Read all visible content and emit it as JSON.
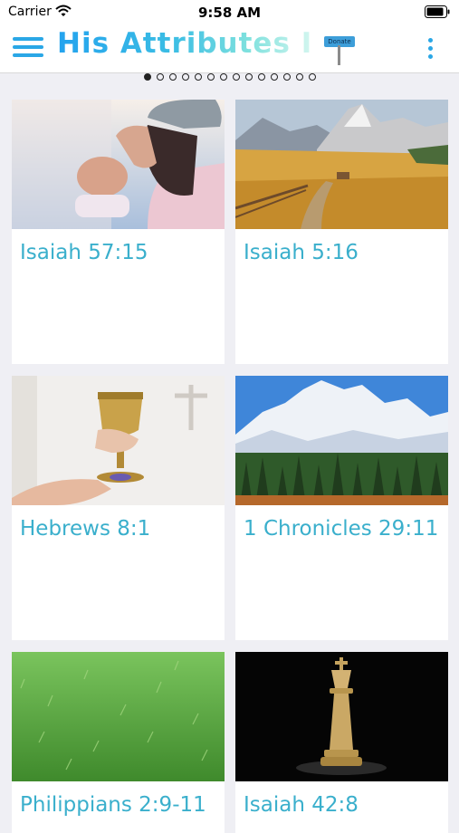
{
  "status_bar": {
    "carrier": "Carrier",
    "time": "9:58 AM"
  },
  "nav": {
    "title": "His Attributes I",
    "donate_label": "Donate"
  },
  "pagination": {
    "total": 14,
    "active_index": 0
  },
  "cards": [
    {
      "title": "Isaiah 57:15",
      "image": "woman-praying-photo"
    },
    {
      "title": "Isaiah 5:16",
      "image": "mountain-meadow-photo"
    },
    {
      "title": "Hebrews 8:1",
      "image": "golden-chalice-photo"
    },
    {
      "title": "1 Chronicles 29:11",
      "image": "snowy-mountain-forest-photo"
    },
    {
      "title": "Philippians 2:9-11",
      "image": "green-grass-photo"
    },
    {
      "title": "Isaiah 42:8",
      "image": "chess-king-photo"
    }
  ],
  "colors": {
    "accent": "#2aa7e6",
    "card_title": "#3aafcc",
    "background": "#efeff4"
  }
}
